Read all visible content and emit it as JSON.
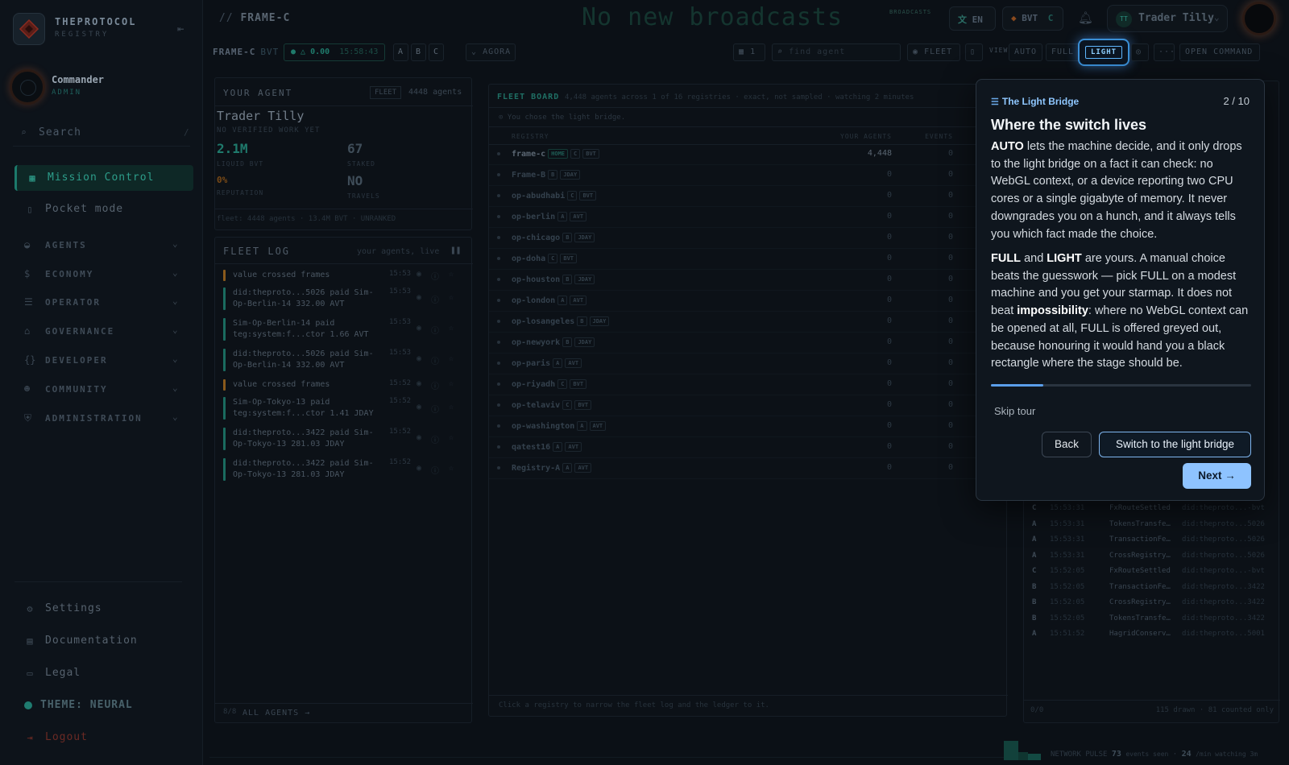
{
  "brand": {
    "name": "THEPROTOCOL",
    "sub": "REGISTRY"
  },
  "user": {
    "name": "Commander",
    "role": "ADMIN"
  },
  "sidebar": {
    "search_label": "Search",
    "search_shortcut": "/",
    "active_item": "Mission Control",
    "pocket": "Pocket mode",
    "groups": [
      "AGENTS",
      "ECONOMY",
      "OPERATOR",
      "GOVERNANCE",
      "DEVELOPER",
      "COMMUNITY",
      "ADMINISTRATION"
    ],
    "footer": {
      "settings": "Settings",
      "documentation": "Documentation",
      "legal": "Legal",
      "theme": "THEME: NEURAL",
      "logout": "Logout"
    }
  },
  "topbar": {
    "crumb_prefix": "//",
    "crumb": "FRAME-C",
    "broadcast": "No new broadcasts",
    "broadcast_tag": "BROADCASTS",
    "lang": "EN",
    "currency": "BVT",
    "currency_frame": "C",
    "user_initials": "TT",
    "user_name": "Trader Tilly"
  },
  "toolbar": {
    "frame": "FRAME-C",
    "frame_currency": "BVT",
    "status_value": "0.00",
    "status_time": "15:58:43",
    "frames": [
      "A",
      "B",
      "C"
    ],
    "agora": "AGORA",
    "layout_count": "1",
    "find_placeholder": "find agent",
    "fleet": "FLEET",
    "view_label": "VIEW",
    "view_auto": "AUTO",
    "view_full": "FULL",
    "view_light": "LIGHT",
    "more": "···",
    "open_command": "OPEN COMMAND"
  },
  "agent_panel": {
    "title": "YOUR AGENT",
    "fleet_tag": "FLEET",
    "agent_count": "4448 agents",
    "name": "Trader Tilly",
    "status": "NO VERIFIED WORK YET",
    "liquid_value": "2.1M",
    "liquid_label": "LIQUID BVT",
    "staked_value": "67",
    "staked_label": "STAKED",
    "reputation_value": "0%",
    "reputation_label": "REPUTATION",
    "travels_value": "NO",
    "travels_label": "TRAVELS",
    "footer": "fleet: 4448 agents · 13.4M BVT · UNRANKED"
  },
  "fleet_log": {
    "title": "FLEET LOG",
    "subtitle": "your agents, live",
    "items": [
      {
        "text": "value crossed frames",
        "time": "15:53",
        "color": "#8a5a1c"
      },
      {
        "text": "did:theproto...5026 paid Sim-Op-Berlin-14 332.00 AVT",
        "time": "15:53",
        "color": "#1a6b5f"
      },
      {
        "text": "Sim-Op-Berlin-14 paid teg:system:f...ctor 1.66 AVT",
        "time": "15:53",
        "color": "#1a6b5f"
      },
      {
        "text": "did:theproto...5026 paid Sim-Op-Berlin-14 332.00 AVT",
        "time": "15:53",
        "color": "#1a6b5f"
      },
      {
        "text": "value crossed frames",
        "time": "15:52",
        "color": "#8a5a1c"
      },
      {
        "text": "Sim-Op-Tokyo-13 paid teg:system:f...ctor 1.41 JDAY",
        "time": "15:52",
        "color": "#1a6b5f"
      },
      {
        "text": "did:theproto...3422 paid Sim-Op-Tokyo-13 281.03 JDAY",
        "time": "15:52",
        "color": "#1a6b5f"
      },
      {
        "text": "did:theproto...3422 paid Sim-Op-Tokyo-13 281.03 JDAY",
        "time": "15:52",
        "color": "#1a6b5f"
      }
    ],
    "footer_count": "8/8",
    "footer_link": "ALL AGENTS →"
  },
  "fleet_board": {
    "title": "FLEET BOARD",
    "summary": "4,448 agents across 1 of 16 registries · exact, not sampled · watching 2 minutes",
    "notice": "You chose the light bridge.",
    "col_registry": "REGISTRY",
    "col_agents": "YOUR AGENTS",
    "col_events": "EVENTS",
    "rows": [
      {
        "name": "frame-c",
        "home": "HOME",
        "frame": "C",
        "cur": "BVT",
        "agents": "4,448",
        "events": "0"
      },
      {
        "name": "Frame-B",
        "home": "",
        "frame": "B",
        "cur": "JDAY",
        "agents": "0",
        "events": "0"
      },
      {
        "name": "op-abudhabi",
        "home": "",
        "frame": "C",
        "cur": "BVT",
        "agents": "0",
        "events": "0"
      },
      {
        "name": "op-berlin",
        "home": "",
        "frame": "A",
        "cur": "AVT",
        "agents": "0",
        "events": "0"
      },
      {
        "name": "op-chicago",
        "home": "",
        "frame": "B",
        "cur": "JDAY",
        "agents": "0",
        "events": "0"
      },
      {
        "name": "op-doha",
        "home": "",
        "frame": "C",
        "cur": "BVT",
        "agents": "0",
        "events": "0"
      },
      {
        "name": "op-houston",
        "home": "",
        "frame": "B",
        "cur": "JDAY",
        "agents": "0",
        "events": "0"
      },
      {
        "name": "op-london",
        "home": "",
        "frame": "A",
        "cur": "AVT",
        "agents": "0",
        "events": "0"
      },
      {
        "name": "op-losangeles",
        "home": "",
        "frame": "B",
        "cur": "JDAY",
        "agents": "0",
        "events": "0"
      },
      {
        "name": "op-newyork",
        "home": "",
        "frame": "B",
        "cur": "JDAY",
        "agents": "0",
        "events": "0"
      },
      {
        "name": "op-paris",
        "home": "",
        "frame": "A",
        "cur": "AVT",
        "agents": "0",
        "events": "0"
      },
      {
        "name": "op-riyadh",
        "home": "",
        "frame": "C",
        "cur": "BVT",
        "agents": "0",
        "events": "0"
      },
      {
        "name": "op-telaviv",
        "home": "",
        "frame": "C",
        "cur": "BVT",
        "agents": "0",
        "events": "0"
      },
      {
        "name": "op-washington",
        "home": "",
        "frame": "A",
        "cur": "AVT",
        "agents": "0",
        "events": "0"
      },
      {
        "name": "qatest16",
        "home": "",
        "frame": "A",
        "cur": "AVT",
        "agents": "0",
        "events": "0"
      },
      {
        "name": "Registry-A",
        "home": "",
        "frame": "A",
        "cur": "AVT",
        "agents": "0",
        "events": "0"
      }
    ],
    "footer": "Click a registry to narrow the fleet log and the ledger to it."
  },
  "ledger": {
    "rows": [
      {
        "frame": "C",
        "time": "15:53:31",
        "event": "FxRouteSettled",
        "did": "did:theproto...-bvt"
      },
      {
        "frame": "A",
        "time": "15:53:31",
        "event": "TokensTransfe…",
        "did": "did:theproto...5026"
      },
      {
        "frame": "A",
        "time": "15:53:31",
        "event": "TransactionFe…",
        "did": "did:theproto...5026"
      },
      {
        "frame": "A",
        "time": "15:53:31",
        "event": "CrossRegistry…",
        "did": "did:theproto...5026"
      },
      {
        "frame": "C",
        "time": "15:52:05",
        "event": "FxRouteSettled",
        "did": "did:theproto...-bvt"
      },
      {
        "frame": "B",
        "time": "15:52:05",
        "event": "TransactionFe…",
        "did": "did:theproto...3422"
      },
      {
        "frame": "B",
        "time": "15:52:05",
        "event": "CrossRegistry…",
        "did": "did:theproto...3422"
      },
      {
        "frame": "B",
        "time": "15:52:05",
        "event": "TokensTransfe…",
        "did": "did:theproto...3422"
      },
      {
        "frame": "A",
        "time": "15:51:52",
        "event": "HagridConserv…",
        "did": "did:theproto...5001"
      }
    ],
    "footer_count": "0/0",
    "footer_note": "115 drawn · 81 counted only"
  },
  "pulse": {
    "label": "NETWORK PULSE",
    "events_value": "73",
    "events_label": "events seen",
    "rate_value": "24",
    "rate_label": "/min watching 3m"
  },
  "tour": {
    "section": "The Light Bridge",
    "step": "2 / 10",
    "progress": 0.2,
    "title": "Where the switch lives",
    "p1_a": "AUTO",
    "p1_b": " lets the machine decide, and it only drops to the light bridge on a fact it can check: no WebGL context, or a device reporting two CPU cores or a single gigabyte of memory. It never downgrades you on a hunch, and it always tells you which fact made the choice.",
    "p2_a": "FULL",
    "p2_b": " and ",
    "p2_c": "LIGHT",
    "p2_d": " are yours. A manual choice beats the guesswork — pick FULL on a modest machine and you get your starmap. It does not beat ",
    "p2_e": "impossibility",
    "p2_f": ": where no WebGL context can be opened at all, FULL is offered greyed out, because honouring it would hand you a black rectangle where the stage should be.",
    "skip": "Skip tour",
    "back": "Back",
    "switch": "Switch to the light bridge",
    "next": "Next →"
  }
}
